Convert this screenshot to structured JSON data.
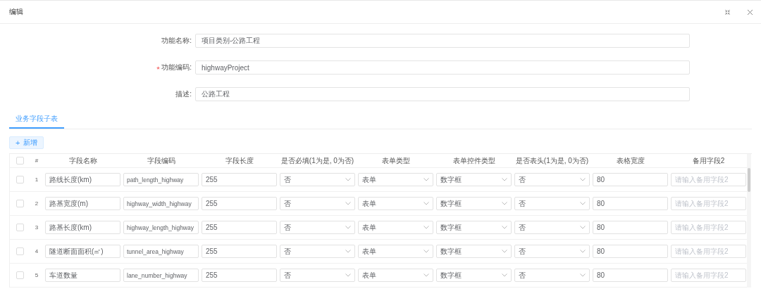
{
  "window": {
    "title": "编辑"
  },
  "form": [
    {
      "label": "功能名称:",
      "value": "项目类别-公路工程",
      "required": false
    },
    {
      "label": "功能编码:",
      "value": "highwayProject",
      "required": true
    },
    {
      "label": "描述:",
      "value": "公路工程",
      "required": false
    }
  ],
  "tabs": [
    {
      "label": "业务字段子表",
      "selected": true
    }
  ],
  "add_button": {
    "icon": "+",
    "label": "新增"
  },
  "table": {
    "header_checked": false,
    "index_header": "#",
    "columns": [
      "字段名称",
      "字段编码",
      "字段长度",
      "是否必填(1为是, 0为否)",
      "表单类型",
      "表单控件类型",
      "是否表头(1为是, 0为否)",
      "表格宽度",
      "备用字段2"
    ],
    "rows": [
      {
        "checked": false,
        "index": "1",
        "cells": [
          {
            "kind": "input",
            "value": "路线长度(km)"
          },
          {
            "kind": "input",
            "value": "path_length_highway"
          },
          {
            "kind": "input",
            "value": "255"
          },
          {
            "kind": "select",
            "value": "否"
          },
          {
            "kind": "select",
            "value": "表单"
          },
          {
            "kind": "select",
            "value": "数字框"
          },
          {
            "kind": "select",
            "value": "否"
          },
          {
            "kind": "input",
            "value": "80"
          },
          {
            "kind": "input",
            "placeholder": "请输入备用字段2"
          }
        ]
      },
      {
        "checked": false,
        "index": "2",
        "cells": [
          {
            "kind": "input",
            "value": "路基宽度(m)"
          },
          {
            "kind": "input",
            "value": "highway_width_highway"
          },
          {
            "kind": "input",
            "value": "255"
          },
          {
            "kind": "select",
            "value": "否"
          },
          {
            "kind": "select",
            "value": "表单"
          },
          {
            "kind": "select",
            "value": "数字框"
          },
          {
            "kind": "select",
            "value": "否"
          },
          {
            "kind": "input",
            "value": "80"
          },
          {
            "kind": "input",
            "placeholder": "请输入备用字段2"
          }
        ]
      },
      {
        "checked": false,
        "index": "3",
        "cells": [
          {
            "kind": "input",
            "value": "路基长度(km)"
          },
          {
            "kind": "input",
            "value": "highway_length_highway"
          },
          {
            "kind": "input",
            "value": "255"
          },
          {
            "kind": "select",
            "value": "否"
          },
          {
            "kind": "select",
            "value": "表单"
          },
          {
            "kind": "select",
            "value": "数字框"
          },
          {
            "kind": "select",
            "value": "否"
          },
          {
            "kind": "input",
            "value": "80"
          },
          {
            "kind": "input",
            "placeholder": "请输入备用字段2"
          }
        ]
      },
      {
        "checked": false,
        "index": "4",
        "cells": [
          {
            "kind": "input",
            "value": "隧道断面面积(㎡)"
          },
          {
            "kind": "input",
            "value": "tunnel_area_highway"
          },
          {
            "kind": "input",
            "value": "255"
          },
          {
            "kind": "select",
            "value": "否"
          },
          {
            "kind": "select",
            "value": "表单"
          },
          {
            "kind": "select",
            "value": "数字框"
          },
          {
            "kind": "select",
            "value": "否"
          },
          {
            "kind": "input",
            "value": "80"
          },
          {
            "kind": "input",
            "placeholder": "请输入备用字段2"
          }
        ]
      },
      {
        "checked": false,
        "index": "5",
        "cells": [
          {
            "kind": "input",
            "value": "车道数量"
          },
          {
            "kind": "input",
            "value": "lane_number_highway"
          },
          {
            "kind": "input",
            "value": "255"
          },
          {
            "kind": "select",
            "value": "否"
          },
          {
            "kind": "select",
            "value": "表单"
          },
          {
            "kind": "select",
            "value": "数字框"
          },
          {
            "kind": "select",
            "value": "否"
          },
          {
            "kind": "input",
            "value": "80"
          },
          {
            "kind": "input",
            "placeholder": "请输入备用字段2"
          }
        ]
      }
    ]
  }
}
